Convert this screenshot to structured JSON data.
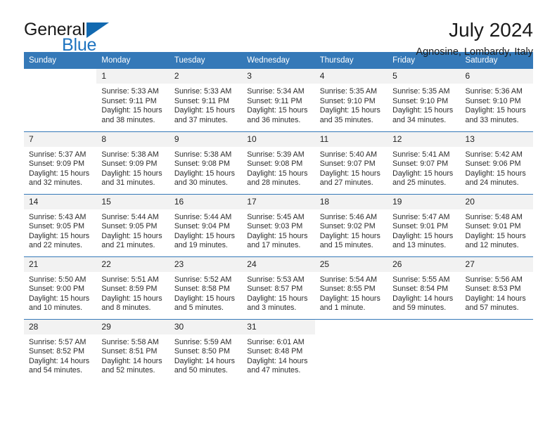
{
  "brand": {
    "word_one": "General",
    "word_two": "Blue",
    "mark": "triangle-logo"
  },
  "header": {
    "title": "July 2024",
    "location": "Agnosine, Lombardy, Italy"
  },
  "calendar": {
    "weekday_headers": [
      "Sunday",
      "Monday",
      "Tuesday",
      "Wednesday",
      "Thursday",
      "Friday",
      "Saturday"
    ],
    "labels": {
      "sunrise": "Sunrise:",
      "sunset": "Sunset:",
      "daylight": "Daylight:"
    },
    "accent_color": "#3579b8",
    "daynum_band_color": "#f2f2f2",
    "weeks": [
      [
        {
          "day": "",
          "blank": true
        },
        {
          "day": "1",
          "sunrise": "Sunrise: 5:33 AM",
          "sunset": "Sunset: 9:11 PM",
          "daylight_line1": "Daylight: 15 hours",
          "daylight_line2": "and 38 minutes."
        },
        {
          "day": "2",
          "sunrise": "Sunrise: 5:33 AM",
          "sunset": "Sunset: 9:11 PM",
          "daylight_line1": "Daylight: 15 hours",
          "daylight_line2": "and 37 minutes."
        },
        {
          "day": "3",
          "sunrise": "Sunrise: 5:34 AM",
          "sunset": "Sunset: 9:11 PM",
          "daylight_line1": "Daylight: 15 hours",
          "daylight_line2": "and 36 minutes."
        },
        {
          "day": "4",
          "sunrise": "Sunrise: 5:35 AM",
          "sunset": "Sunset: 9:10 PM",
          "daylight_line1": "Daylight: 15 hours",
          "daylight_line2": "and 35 minutes."
        },
        {
          "day": "5",
          "sunrise": "Sunrise: 5:35 AM",
          "sunset": "Sunset: 9:10 PM",
          "daylight_line1": "Daylight: 15 hours",
          "daylight_line2": "and 34 minutes."
        },
        {
          "day": "6",
          "sunrise": "Sunrise: 5:36 AM",
          "sunset": "Sunset: 9:10 PM",
          "daylight_line1": "Daylight: 15 hours",
          "daylight_line2": "and 33 minutes."
        }
      ],
      [
        {
          "day": "7",
          "sunrise": "Sunrise: 5:37 AM",
          "sunset": "Sunset: 9:09 PM",
          "daylight_line1": "Daylight: 15 hours",
          "daylight_line2": "and 32 minutes."
        },
        {
          "day": "8",
          "sunrise": "Sunrise: 5:38 AM",
          "sunset": "Sunset: 9:09 PM",
          "daylight_line1": "Daylight: 15 hours",
          "daylight_line2": "and 31 minutes."
        },
        {
          "day": "9",
          "sunrise": "Sunrise: 5:38 AM",
          "sunset": "Sunset: 9:08 PM",
          "daylight_line1": "Daylight: 15 hours",
          "daylight_line2": "and 30 minutes."
        },
        {
          "day": "10",
          "sunrise": "Sunrise: 5:39 AM",
          "sunset": "Sunset: 9:08 PM",
          "daylight_line1": "Daylight: 15 hours",
          "daylight_line2": "and 28 minutes."
        },
        {
          "day": "11",
          "sunrise": "Sunrise: 5:40 AM",
          "sunset": "Sunset: 9:07 PM",
          "daylight_line1": "Daylight: 15 hours",
          "daylight_line2": "and 27 minutes."
        },
        {
          "day": "12",
          "sunrise": "Sunrise: 5:41 AM",
          "sunset": "Sunset: 9:07 PM",
          "daylight_line1": "Daylight: 15 hours",
          "daylight_line2": "and 25 minutes."
        },
        {
          "day": "13",
          "sunrise": "Sunrise: 5:42 AM",
          "sunset": "Sunset: 9:06 PM",
          "daylight_line1": "Daylight: 15 hours",
          "daylight_line2": "and 24 minutes."
        }
      ],
      [
        {
          "day": "14",
          "sunrise": "Sunrise: 5:43 AM",
          "sunset": "Sunset: 9:05 PM",
          "daylight_line1": "Daylight: 15 hours",
          "daylight_line2": "and 22 minutes."
        },
        {
          "day": "15",
          "sunrise": "Sunrise: 5:44 AM",
          "sunset": "Sunset: 9:05 PM",
          "daylight_line1": "Daylight: 15 hours",
          "daylight_line2": "and 21 minutes."
        },
        {
          "day": "16",
          "sunrise": "Sunrise: 5:44 AM",
          "sunset": "Sunset: 9:04 PM",
          "daylight_line1": "Daylight: 15 hours",
          "daylight_line2": "and 19 minutes."
        },
        {
          "day": "17",
          "sunrise": "Sunrise: 5:45 AM",
          "sunset": "Sunset: 9:03 PM",
          "daylight_line1": "Daylight: 15 hours",
          "daylight_line2": "and 17 minutes."
        },
        {
          "day": "18",
          "sunrise": "Sunrise: 5:46 AM",
          "sunset": "Sunset: 9:02 PM",
          "daylight_line1": "Daylight: 15 hours",
          "daylight_line2": "and 15 minutes."
        },
        {
          "day": "19",
          "sunrise": "Sunrise: 5:47 AM",
          "sunset": "Sunset: 9:01 PM",
          "daylight_line1": "Daylight: 15 hours",
          "daylight_line2": "and 13 minutes."
        },
        {
          "day": "20",
          "sunrise": "Sunrise: 5:48 AM",
          "sunset": "Sunset: 9:01 PM",
          "daylight_line1": "Daylight: 15 hours",
          "daylight_line2": "and 12 minutes."
        }
      ],
      [
        {
          "day": "21",
          "sunrise": "Sunrise: 5:50 AM",
          "sunset": "Sunset: 9:00 PM",
          "daylight_line1": "Daylight: 15 hours",
          "daylight_line2": "and 10 minutes."
        },
        {
          "day": "22",
          "sunrise": "Sunrise: 5:51 AM",
          "sunset": "Sunset: 8:59 PM",
          "daylight_line1": "Daylight: 15 hours",
          "daylight_line2": "and 8 minutes."
        },
        {
          "day": "23",
          "sunrise": "Sunrise: 5:52 AM",
          "sunset": "Sunset: 8:58 PM",
          "daylight_line1": "Daylight: 15 hours",
          "daylight_line2": "and 5 minutes."
        },
        {
          "day": "24",
          "sunrise": "Sunrise: 5:53 AM",
          "sunset": "Sunset: 8:57 PM",
          "daylight_line1": "Daylight: 15 hours",
          "daylight_line2": "and 3 minutes."
        },
        {
          "day": "25",
          "sunrise": "Sunrise: 5:54 AM",
          "sunset": "Sunset: 8:55 PM",
          "daylight_line1": "Daylight: 15 hours",
          "daylight_line2": "and 1 minute."
        },
        {
          "day": "26",
          "sunrise": "Sunrise: 5:55 AM",
          "sunset": "Sunset: 8:54 PM",
          "daylight_line1": "Daylight: 14 hours",
          "daylight_line2": "and 59 minutes."
        },
        {
          "day": "27",
          "sunrise": "Sunrise: 5:56 AM",
          "sunset": "Sunset: 8:53 PM",
          "daylight_line1": "Daylight: 14 hours",
          "daylight_line2": "and 57 minutes."
        }
      ],
      [
        {
          "day": "28",
          "sunrise": "Sunrise: 5:57 AM",
          "sunset": "Sunset: 8:52 PM",
          "daylight_line1": "Daylight: 14 hours",
          "daylight_line2": "and 54 minutes."
        },
        {
          "day": "29",
          "sunrise": "Sunrise: 5:58 AM",
          "sunset": "Sunset: 8:51 PM",
          "daylight_line1": "Daylight: 14 hours",
          "daylight_line2": "and 52 minutes."
        },
        {
          "day": "30",
          "sunrise": "Sunrise: 5:59 AM",
          "sunset": "Sunset: 8:50 PM",
          "daylight_line1": "Daylight: 14 hours",
          "daylight_line2": "and 50 minutes."
        },
        {
          "day": "31",
          "sunrise": "Sunrise: 6:01 AM",
          "sunset": "Sunset: 8:48 PM",
          "daylight_line1": "Daylight: 14 hours",
          "daylight_line2": "and 47 minutes."
        },
        {
          "day": "",
          "blank": true
        },
        {
          "day": "",
          "blank": true
        },
        {
          "day": "",
          "blank": true
        }
      ]
    ]
  }
}
